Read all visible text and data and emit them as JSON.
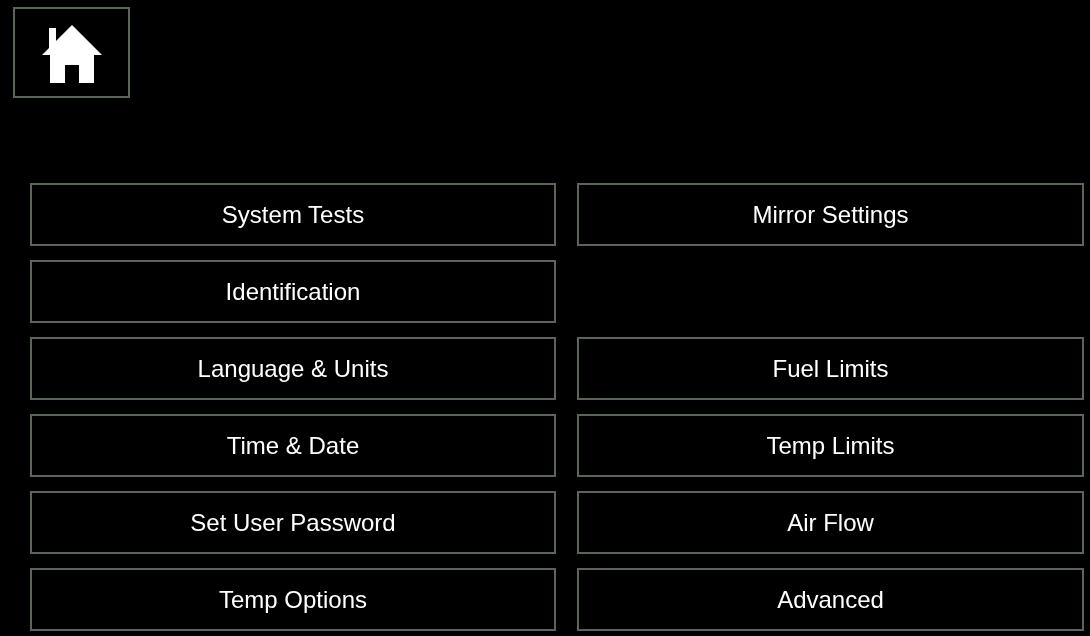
{
  "rows": [
    {
      "left": "System Tests",
      "right": "Mirror Settings"
    },
    {
      "left": "Identification"
    },
    {
      "left": "Language & Units",
      "right": "Fuel Limits"
    },
    {
      "left": "Time & Date",
      "right": "Temp Limits"
    },
    {
      "left": "Set User Password",
      "right": "Air Flow"
    },
    {
      "left": "Temp Options",
      "right": "Advanced"
    }
  ]
}
